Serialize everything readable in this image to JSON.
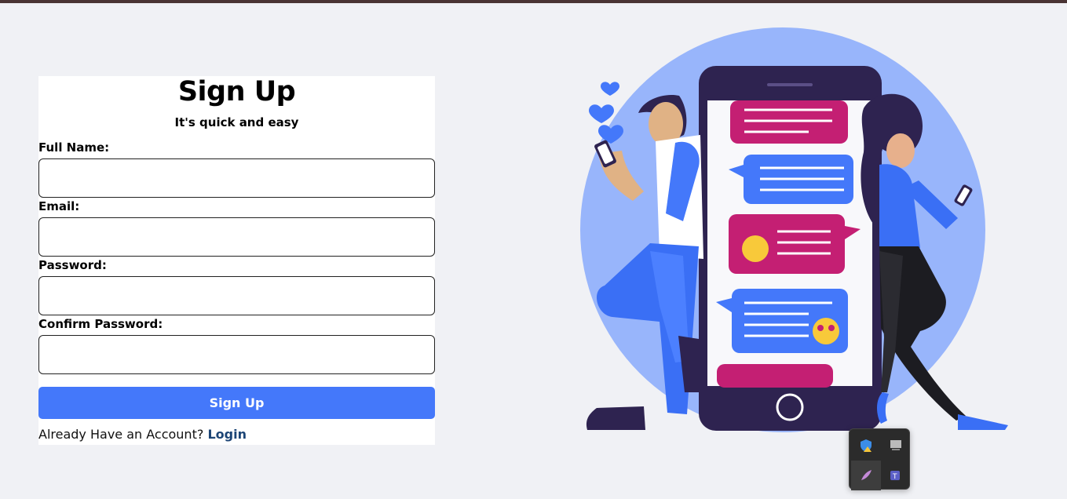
{
  "form": {
    "title": "Sign Up",
    "subtitle": "It's quick and easy",
    "fields": [
      {
        "label": "Full Name:",
        "value": "",
        "placeholder": ""
      },
      {
        "label": "Email:",
        "value": "",
        "placeholder": ""
      },
      {
        "label": "Password:",
        "value": "",
        "placeholder": ""
      },
      {
        "label": "Confirm Password:",
        "value": "",
        "placeholder": ""
      }
    ],
    "submit_label": "Sign Up",
    "login_prompt": "Already Have an Account?",
    "login_link": "Login"
  },
  "colors": {
    "background": "#f0f1f5",
    "primary_button": "#4478fa",
    "login_link": "#1c4576",
    "circle": "#98b5fb",
    "phone": "#2e2350",
    "bubble_pink": "#c41f73",
    "bubble_blue": "#4478fa"
  },
  "tray": {
    "icons": [
      "windows-security-warning-icon",
      "display-icon",
      "feather-icon",
      "teams-icon"
    ]
  }
}
